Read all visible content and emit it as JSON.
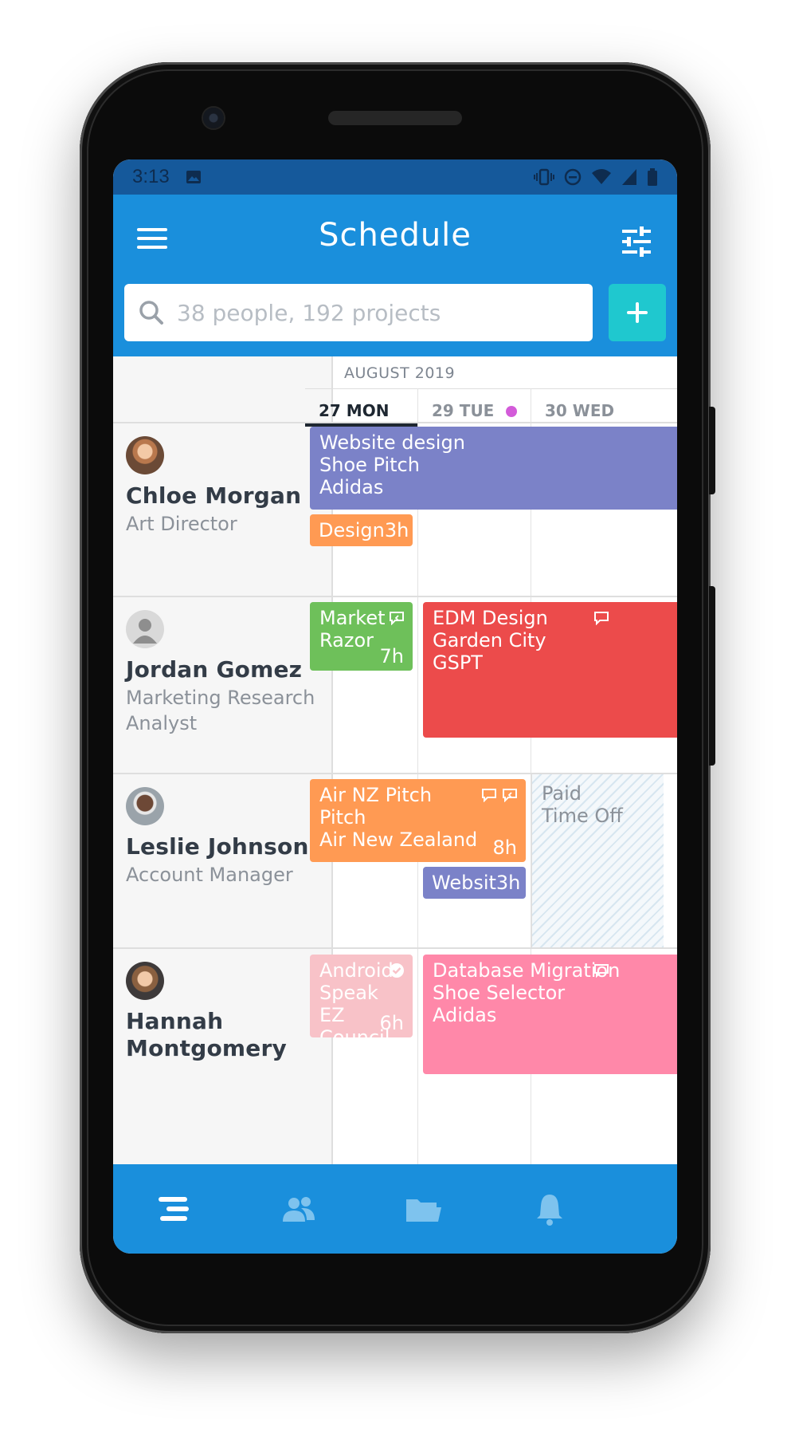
{
  "status_bar": {
    "time": "3:13"
  },
  "header": {
    "title": "Schedule"
  },
  "search": {
    "placeholder": "38 people, 192 projects"
  },
  "calendar": {
    "month": "AUGUST 2019",
    "days": [
      "27 MON",
      "29 TUE",
      "30 WED"
    ],
    "day_dot_colors": [
      "#d35bd9",
      "#1fb3b3"
    ]
  },
  "people": [
    {
      "name": "Chloe Morgan",
      "role": "Art Director"
    },
    {
      "name": "Jordan Gomez",
      "role": "Marketing Research Analyst"
    },
    {
      "name": "Leslie Johnson",
      "role": "Account Manager"
    },
    {
      "name": "Hannah Montgomery",
      "role": ""
    }
  ],
  "allocations": {
    "chloe_1": {
      "line1": "Website design",
      "line2": "Shoe Pitch",
      "line3": "Adidas",
      "color": "#7b82c8"
    },
    "chloe_2": {
      "label": "Design",
      "hours": "3h",
      "color": "#ff9a53"
    },
    "jordan_1": {
      "line1": "Market",
      "line2": "Razor",
      "hours": "7h",
      "color": "#6ec05a"
    },
    "jordan_2": {
      "line1": "EDM Design",
      "line2": "Garden City",
      "line3": "GSPT",
      "color": "#ec4b4b"
    },
    "leslie_1": {
      "line1": "Air NZ Pitch",
      "line2": "Pitch",
      "line3": "Air New Zealand",
      "hours": "8h",
      "color": "#ff9a53"
    },
    "leslie_2": {
      "label": "Websit",
      "hours": "3h",
      "color": "#7b82c8"
    },
    "leslie_timeoff": {
      "line1": "Paid",
      "line2": "Time Off"
    },
    "hannah_1": {
      "line1": "Android",
      "line2": "Speak EZ",
      "line3": "Council",
      "hours": "6h",
      "color": "#f8c2c8"
    },
    "hannah_2": {
      "line1": "Database Migration",
      "line2": "Shoe Selector",
      "line3": "Adidas",
      "color": "#ff88a9"
    }
  },
  "bottom_nav": {
    "items": [
      {
        "icon": "schedule-icon",
        "active": true
      },
      {
        "icon": "people-icon",
        "active": false
      },
      {
        "icon": "projects-folder-icon",
        "active": false
      },
      {
        "icon": "notifications-bell-icon",
        "active": false
      }
    ]
  }
}
